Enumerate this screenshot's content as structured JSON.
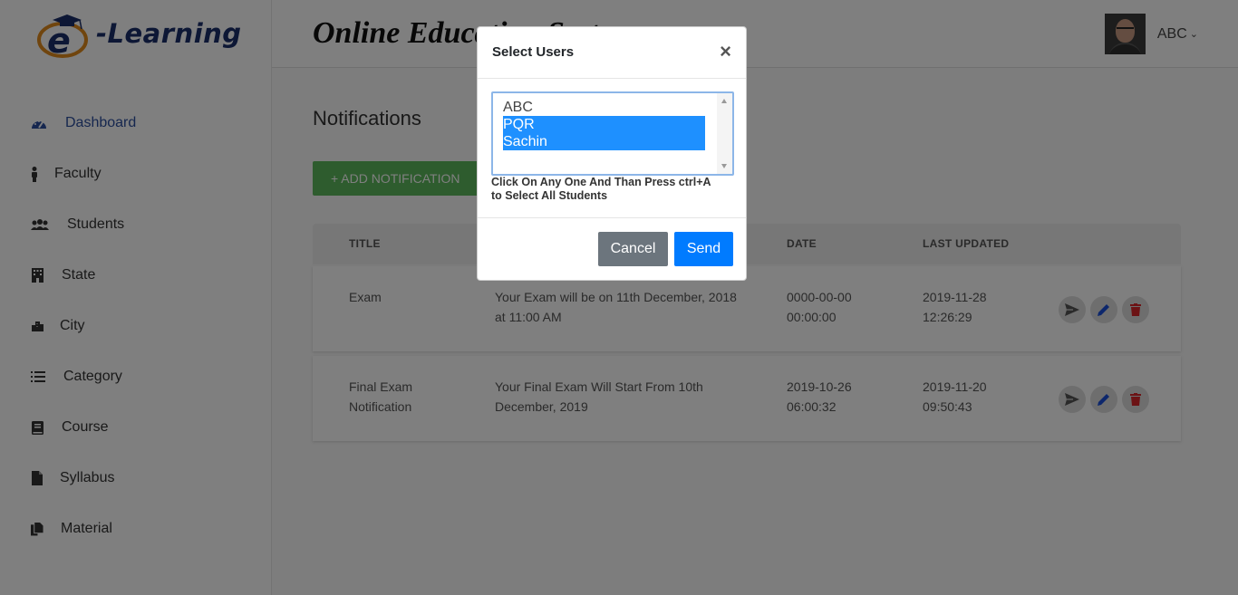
{
  "brand": {
    "logo_text": "-Learning",
    "logo_letter": "e"
  },
  "header": {
    "title": "Online Education System",
    "user_name": "ABC"
  },
  "sidebar": {
    "items": [
      {
        "label": "Dashboard",
        "icon": "dashboard-icon",
        "active": true
      },
      {
        "label": "Faculty",
        "icon": "user-icon"
      },
      {
        "label": "Students",
        "icon": "users-icon"
      },
      {
        "label": "State",
        "icon": "building-icon"
      },
      {
        "label": "City",
        "icon": "city-icon"
      },
      {
        "label": "Category",
        "icon": "list-icon"
      },
      {
        "label": "Course",
        "icon": "book-icon"
      },
      {
        "label": "Syllabus",
        "icon": "file-icon"
      },
      {
        "label": "Material",
        "icon": "files-icon"
      }
    ]
  },
  "main": {
    "page_title": "Notifications",
    "add_button": "+ ADD NOTIFICATION",
    "table": {
      "headers": [
        "TITLE",
        "DATE",
        "LAST UPDATED"
      ],
      "rows": [
        {
          "title": "Exam",
          "description_1": "Your Exam will be on 11th December, 2018",
          "description_2": "at 11:00 AM",
          "date_1": "0000-00-00",
          "date_2": "00:00:00",
          "updated_1": "2019-11-28",
          "updated_2": "12:26:29"
        },
        {
          "title_1": "Final Exam",
          "title_2": "Notification",
          "description_1": "Your Final Exam Will Start From 10th",
          "description_2": "December, 2019",
          "date_1": "2019-10-26",
          "date_2": "06:00:32",
          "updated_1": "2019-11-20",
          "updated_2": "09:50:43"
        }
      ]
    }
  },
  "modal": {
    "title": "Select Users",
    "close": "×",
    "options": [
      {
        "label": "ABC",
        "selected": false
      },
      {
        "label": "PQR",
        "selected": true
      },
      {
        "label": "Sachin",
        "selected": true
      }
    ],
    "hint_1": "Click On Any One And Than Press ctrl+A",
    "hint_2": "to Select All Students",
    "cancel": "Cancel",
    "send": "Send"
  },
  "colors": {
    "accent": "#2c4f9e",
    "add_button": "#5cb85c",
    "send_button": "#007bff",
    "cancel_button": "#6c757d",
    "selected_option": "#1e90ff",
    "edit_icon": "#1a4fd8",
    "delete_icon": "#d9262b"
  }
}
